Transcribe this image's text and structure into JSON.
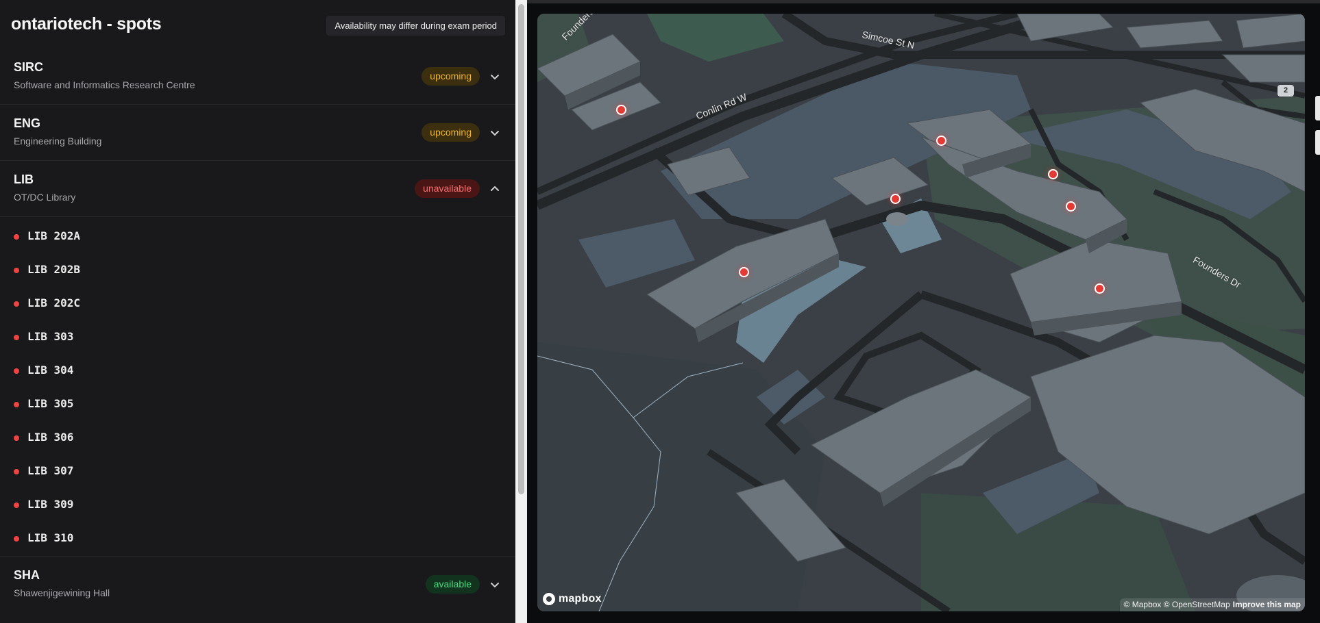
{
  "app": {
    "title": "ontariotech - spots",
    "notice": "Availability may differ during exam period"
  },
  "buildings": [
    {
      "code": "SIRC",
      "name": "Software and Informatics Research Centre",
      "status": "upcoming",
      "expanded": false
    },
    {
      "code": "ENG",
      "name": "Engineering Building",
      "status": "upcoming",
      "expanded": false
    },
    {
      "code": "LIB",
      "name": "OT/DC Library",
      "status": "unavailable",
      "expanded": true
    },
    {
      "code": "SHA",
      "name": "Shawenjigewining Hall",
      "status": "available",
      "expanded": false
    }
  ],
  "rooms": [
    "LIB 202A",
    "LIB 202B",
    "LIB 202C",
    "LIB 303",
    "LIB 304",
    "LIB 305",
    "LIB 306",
    "LIB 307",
    "LIB 309",
    "LIB 310"
  ],
  "room_status_color": "#ef4444",
  "status_colors": {
    "upcoming": "#f2b52a",
    "unavailable": "#f87171",
    "available": "#4ade80"
  },
  "map": {
    "streets": [
      "Founders Dr",
      "Simcoe St N",
      "Conlin Rd W",
      "Founders Dr"
    ],
    "floor_level": "2",
    "logo": "mapbox",
    "attribution": "© Mapbox © OpenStreetMap",
    "improve_link": "Improve this map",
    "pin_count": 7,
    "pin_color": "#e53935"
  }
}
